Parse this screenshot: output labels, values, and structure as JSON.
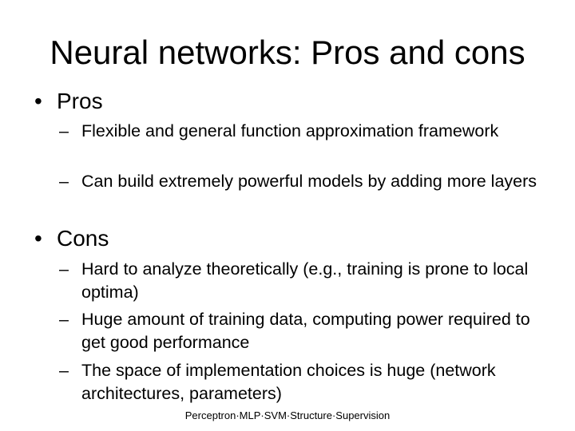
{
  "slide": {
    "title": "Neural networks: Pros and cons",
    "sections": [
      {
        "bullet": "•",
        "heading": "Pros",
        "items": [
          {
            "marker": "–",
            "text": "Flexible and general function approximation framework"
          },
          {
            "marker": "–",
            "text": "Can build extremely powerful models by adding more layers"
          }
        ]
      },
      {
        "bullet": "•",
        "heading": "Cons",
        "items": [
          {
            "marker": "–",
            "text": "Hard to analyze theoretically (e.g., training is prone to local optima)"
          },
          {
            "marker": "–",
            "text": "Huge amount of training data, computing power required to get good performance"
          },
          {
            "marker": "–",
            "text": "The space of implementation choices is huge (network architectures, parameters)"
          }
        ]
      }
    ],
    "footer": "Perceptron·MLP·SVM·Structure·Supervision"
  }
}
